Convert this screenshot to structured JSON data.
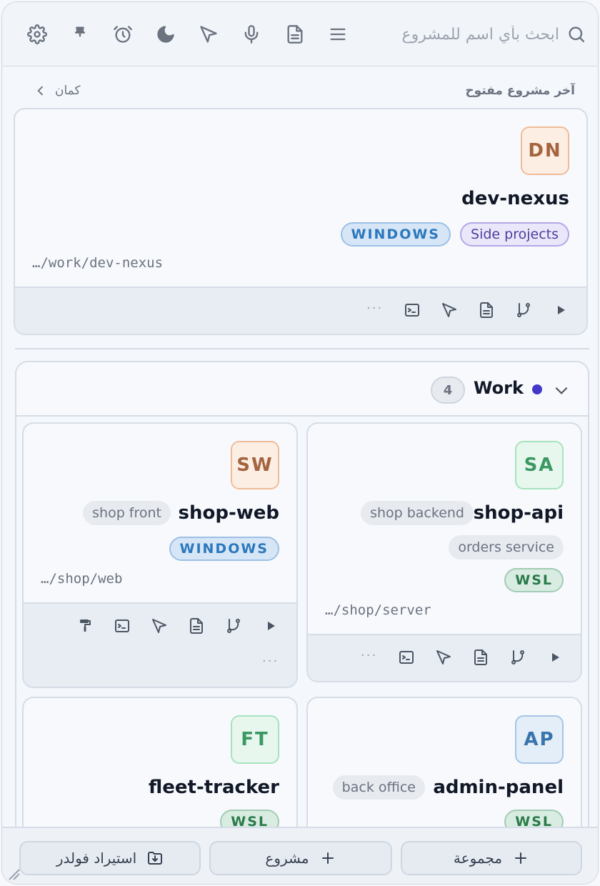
{
  "search": {
    "placeholder": "ابحث بأي اسم للمشروع"
  },
  "recent": {
    "title": "آخر مشروع مفتوح",
    "more_label": "كمان",
    "project": {
      "initials": "DN",
      "name": "dev-nexus",
      "tags": [
        "WINDOWS",
        "Side projects"
      ],
      "path": "…/work/dev-nexus"
    }
  },
  "group": {
    "name": "Work",
    "count": "4",
    "dot_color": "#4338ca",
    "projects": [
      {
        "initials": "SA",
        "name": "shop-api",
        "chips": [
          "shop backend",
          "orders service"
        ],
        "env": "WSL",
        "path": "…/shop/server"
      },
      {
        "initials": "SW",
        "name": "shop-web",
        "chips": [
          "shop front"
        ],
        "env": "WINDOWS",
        "path": "…/shop/web"
      },
      {
        "initials": "AP",
        "name": "admin-panel",
        "chips": [
          "back office"
        ],
        "env": "WSL"
      },
      {
        "initials": "FT",
        "name": "fleet-tracker",
        "chips": [],
        "env": "WSL"
      }
    ]
  },
  "actions": {
    "more": "···"
  },
  "footer": {
    "group_btn": "مجموعة",
    "project_btn": "مشروع",
    "import_btn": "استيراد فولدر"
  },
  "icons": [
    "search-icon",
    "menu-icon",
    "document-icon",
    "microphone-icon",
    "send-icon",
    "moon-icon",
    "alarm-icon",
    "pin-icon",
    "gear-icon",
    "chevron-left-icon",
    "chevron-down-icon",
    "play-icon",
    "git-branch-icon",
    "terminal-icon",
    "paint-roller-icon",
    "plus-icon",
    "folder-import-icon"
  ]
}
